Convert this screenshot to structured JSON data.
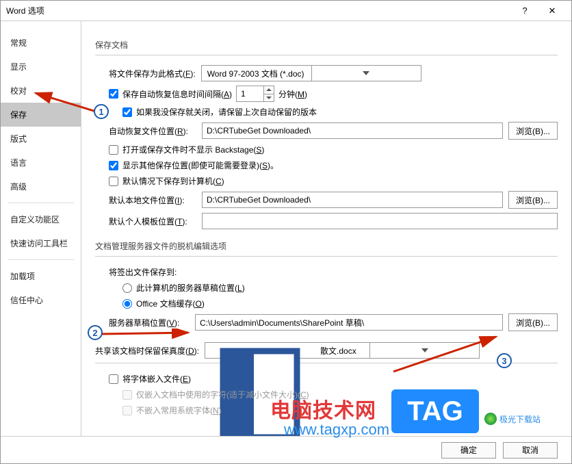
{
  "title": "Word 选项",
  "titlebar_buttons": {
    "help": "?",
    "close": "✕"
  },
  "sidebar": {
    "items": [
      {
        "label": "常规"
      },
      {
        "label": "显示"
      },
      {
        "label": "校对"
      },
      {
        "label": "保存",
        "selected": true
      },
      {
        "label": "版式"
      },
      {
        "label": "语言"
      },
      {
        "label": "高级"
      }
    ],
    "items_group2": [
      {
        "label": "自定义功能区"
      },
      {
        "label": "快速访问工具栏"
      }
    ],
    "items_group3": [
      {
        "label": "加载项"
      },
      {
        "label": "信任中心"
      }
    ]
  },
  "section_save": {
    "header": "保存文档",
    "format_label_a": "将文件保存为此格式(",
    "format_label_u": "F",
    "format_label_b": "):",
    "format_value": "Word 97-2003 文档 (*.doc)",
    "autorecover_check": "保存自动恢复信息时间间隔(",
    "autorecover_u": "A",
    "autorecover_b": ")",
    "autorecover_value": "1",
    "minutes_a": "分钟(",
    "minutes_u": "M",
    "minutes_b": ")",
    "keep_last_label": "如果我没保存就关闭，请保留上次自动保留的版本",
    "autorecover_loc_a": "自动恢复文件位置(",
    "autorecover_loc_u": "R",
    "autorecover_loc_b": "):",
    "autorecover_loc_value": "D:\\CRTubeGet Downloaded\\",
    "browse_a": "浏览(",
    "browse_u": "B",
    "browse_b": ")...",
    "backstage_a": "打开或保存文件时不显示 Backstage(",
    "backstage_u": "S",
    "backstage_b": ")",
    "show_other_a": "显示其他保存位置(即使可能需要登录)(",
    "show_other_u": "S",
    "show_other_b": ")。",
    "save_local_a": "默认情况下保存到计算机(",
    "save_local_u": "C",
    "save_local_b": ")",
    "default_loc_a": "默认本地文件位置(",
    "default_loc_u": "I",
    "default_loc_b": "):",
    "default_loc_value": "D:\\CRTubeGet Downloaded\\",
    "template_loc_a": "默认个人模板位置(",
    "template_loc_u": "T",
    "template_loc_b": "):",
    "template_loc_value": ""
  },
  "section_server": {
    "header": "文档管理服务器文件的脱机编辑选项",
    "save_checkout_label": "将签出文件保存到:",
    "radio1_a": "此计算机的服务器草稿位置(",
    "radio1_u": "L",
    "radio1_b": ")",
    "radio2_a": "Office 文档缓存(",
    "radio2_u": "O",
    "radio2_b": ")",
    "draft_loc_a": "服务器草稿位置(",
    "draft_loc_u": "V",
    "draft_loc_b": "):",
    "draft_loc_value": "C:\\Users\\admin\\Documents\\SharePoint 草稿\\"
  },
  "section_share": {
    "header_a": "共享该文档时保留保真度(",
    "header_u": "D",
    "header_b": "):",
    "doc_value": "散文.docx",
    "embed_a": "将字体嵌入文件(",
    "embed_u": "E",
    "embed_b": ")",
    "embed_sub1_a": "仅嵌入文档中使用的字符(适于减小文件大小)(",
    "embed_sub1_u": "C",
    "embed_sub1_b": ")",
    "embed_sub2_a": "不嵌入常用系统字体(",
    "embed_sub2_u": "N",
    "embed_sub2_b": ")"
  },
  "footer": {
    "ok": "确定",
    "cancel": "取消"
  },
  "markers": {
    "m1": "1",
    "m2": "2",
    "m3": "3"
  },
  "watermarks": {
    "text1": "电脑技术网",
    "text1b": "www.tagxp.com",
    "tag": "TAG",
    "text2": "极光下载站"
  }
}
